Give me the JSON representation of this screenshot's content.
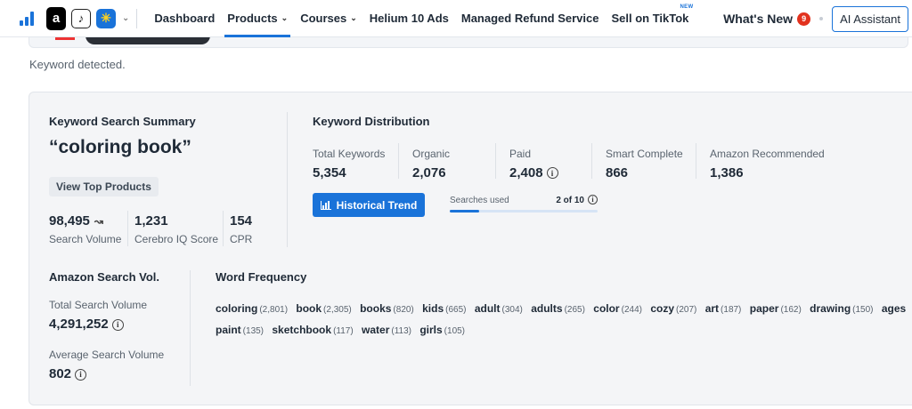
{
  "nav": {
    "marketplace_icons": [
      {
        "name": "amazon-icon",
        "glyph": "a"
      },
      {
        "name": "tiktok-icon",
        "glyph": "♪"
      },
      {
        "name": "walmart-icon",
        "glyph": "✳"
      }
    ],
    "links": [
      {
        "label": "Dashboard",
        "dropdown": false
      },
      {
        "label": "Products",
        "dropdown": true,
        "active": true
      },
      {
        "label": "Courses",
        "dropdown": true
      },
      {
        "label": "Helium 10 Ads",
        "dropdown": false
      },
      {
        "label": "Managed Refund Service",
        "dropdown": false
      },
      {
        "label": "Sell on TikTok",
        "dropdown": false,
        "badge": "NEW"
      }
    ],
    "whats_new": "What's New",
    "whats_new_count": "9",
    "ai_assistant": "AI Assistant"
  },
  "status": "Keyword detected.",
  "summary": {
    "title": "Keyword Search Summary",
    "keyword": "“coloring book”",
    "view_top_products": "View Top Products",
    "metrics": [
      {
        "value": "98,495",
        "label": "Search Volume"
      },
      {
        "value": "1,231",
        "label": "Cerebro IQ Score"
      },
      {
        "value": "154",
        "label": "CPR"
      }
    ]
  },
  "distribution": {
    "title": "Keyword Distribution",
    "metrics": [
      {
        "label": "Total Keywords",
        "value": "5,354"
      },
      {
        "label": "Organic",
        "value": "2,076"
      },
      {
        "label": "Paid",
        "value": "2,408"
      },
      {
        "label": "Smart Complete",
        "value": "866"
      },
      {
        "label": "Amazon Recommended",
        "value": "1,386"
      }
    ],
    "historical_trend": "Historical Trend",
    "searches_used_label": "Searches used",
    "searches_used_value": "2 of 10",
    "searches_used_fraction": 0.2
  },
  "amazon_search_vol": {
    "title": "Amazon Search Vol.",
    "total_label": "Total Search Volume",
    "total_value": "4,291,252",
    "average_label": "Average Search Volume",
    "average_value": "802"
  },
  "word_frequency": {
    "title": "Word Frequency",
    "words": [
      {
        "word": "coloring",
        "count": "(2,801)"
      },
      {
        "word": "book",
        "count": "(2,305)"
      },
      {
        "word": "books",
        "count": "(820)"
      },
      {
        "word": "kids",
        "count": "(665)"
      },
      {
        "word": "adult",
        "count": "(304)"
      },
      {
        "word": "adults",
        "count": "(265)"
      },
      {
        "word": "color",
        "count": "(244)"
      },
      {
        "word": "cozy",
        "count": "(207)"
      },
      {
        "word": "art",
        "count": "(187)"
      },
      {
        "word": "paper",
        "count": "(162)"
      },
      {
        "word": "drawing",
        "count": "(150)"
      },
      {
        "word": "ages",
        "count": ""
      },
      {
        "word": "paint",
        "count": "(135)"
      },
      {
        "word": "sketchbook",
        "count": "(117)"
      },
      {
        "word": "water",
        "count": "(113)"
      },
      {
        "word": "girls",
        "count": "(105)"
      }
    ]
  },
  "colors": {
    "accent": "#1a73d9",
    "badge": "#e2321e"
  }
}
